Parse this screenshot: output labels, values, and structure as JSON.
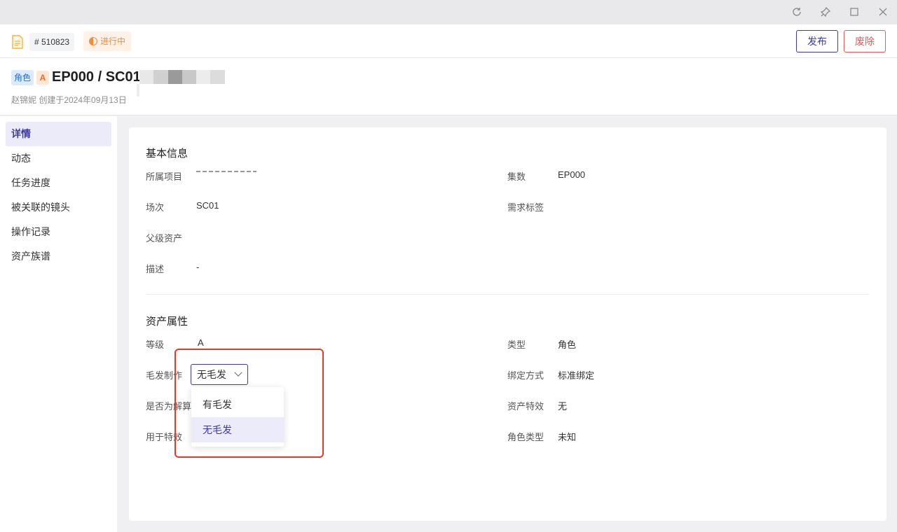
{
  "window_controls": [
    "refresh-icon",
    "pin-icon",
    "maximize-icon",
    "close-icon"
  ],
  "header": {
    "id_tag": "# 510823",
    "status": "进行中",
    "publish_label": "发布",
    "discard_label": "废除"
  },
  "title": {
    "type_badge": "角色",
    "grade_badge": "A",
    "name": "EP000 / SC01",
    "creator_line": "赵锦妮 创建于2024年09月13日"
  },
  "sidebar": {
    "items": [
      {
        "label": "详情",
        "active": true
      },
      {
        "label": "动态",
        "active": false
      },
      {
        "label": "任务进度",
        "active": false
      },
      {
        "label": "被关联的镜头",
        "active": false
      },
      {
        "label": "操作记录",
        "active": false
      },
      {
        "label": "资产族谱",
        "active": false
      }
    ]
  },
  "basic_info": {
    "title": "基本信息",
    "project_label": "所属项目",
    "episode_label": "集数",
    "episode_value": "EP000",
    "scene_label": "场次",
    "scene_value": "SC01",
    "tags_label": "需求标签",
    "parent_label": "父级资产",
    "desc_label": "描述",
    "desc_value": "-"
  },
  "asset_attrs": {
    "title": "资产属性",
    "grade_label": "等级",
    "grade_value": "A",
    "type_label": "类型",
    "type_value": "角色",
    "hair_label": "毛发制作",
    "hair_value": "无毛发",
    "binding_label": "绑定方式",
    "binding_value": "标准绑定",
    "dissolve_label": "是否为解算",
    "effect_label": "资产特效",
    "effect_value": "无",
    "for_fx_label": "用于特效",
    "role_type_label": "角色类型",
    "role_type_value": "未知"
  },
  "dropdown": {
    "options": [
      {
        "label": "有毛发",
        "selected": false
      },
      {
        "label": "无毛发",
        "selected": true
      }
    ]
  },
  "colors": {
    "accent": "#3d3aa8",
    "danger": "#e25a5a",
    "status_orange": "#f08a3c",
    "annotation_red": "#e2392b"
  }
}
